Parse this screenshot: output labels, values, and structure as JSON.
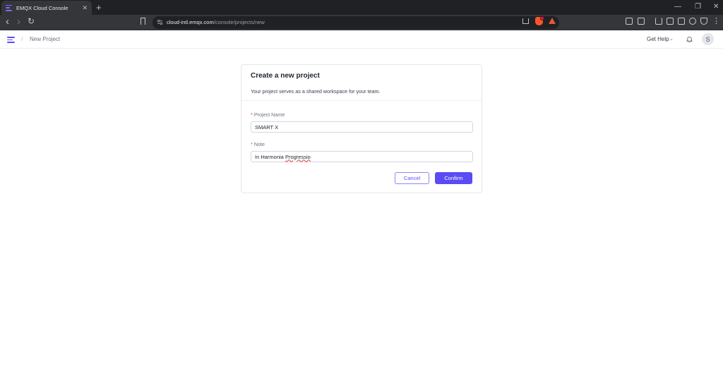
{
  "browser": {
    "tab_title": "EMQX Cloud Console",
    "tab_close": "✕",
    "new_tab": "+",
    "url_host": "cloud-intl.emqx.com",
    "url_path": "/console/projects/new",
    "win_minimize": "—",
    "win_restore": "❐",
    "win_close": "✕",
    "back": "‹",
    "forward": "›",
    "reload": "↻",
    "menu": "⋮"
  },
  "header": {
    "breadcrumb_sep": "/",
    "breadcrumb": "New Project",
    "get_help": "Get Help",
    "get_help_chevron": "⌄",
    "avatar_initial": "S"
  },
  "form": {
    "title": "Create a new project",
    "description": "Your project serves as a shared workspace for your team.",
    "project_name_label": "Project Name",
    "project_name_value": "SMART X",
    "note_label": "Note",
    "note_value_prefix": "In Harmonia ",
    "note_value_misspelled": "Progressio",
    "required_mark": "*",
    "cancel_label": "Cancel",
    "confirm_label": "Confirm"
  },
  "colors": {
    "accent": "#5b4bf5",
    "required": "#ef4444",
    "browser_dark": "#202124",
    "toolbar": "#35363a"
  },
  "icons": [
    "menu-icon",
    "bell-icon",
    "bookmark-icon",
    "share-icon",
    "brave-icon",
    "extensions-icon",
    "download-icon",
    "sidebar-icon",
    "wallet-icon",
    "shield-icon"
  ]
}
